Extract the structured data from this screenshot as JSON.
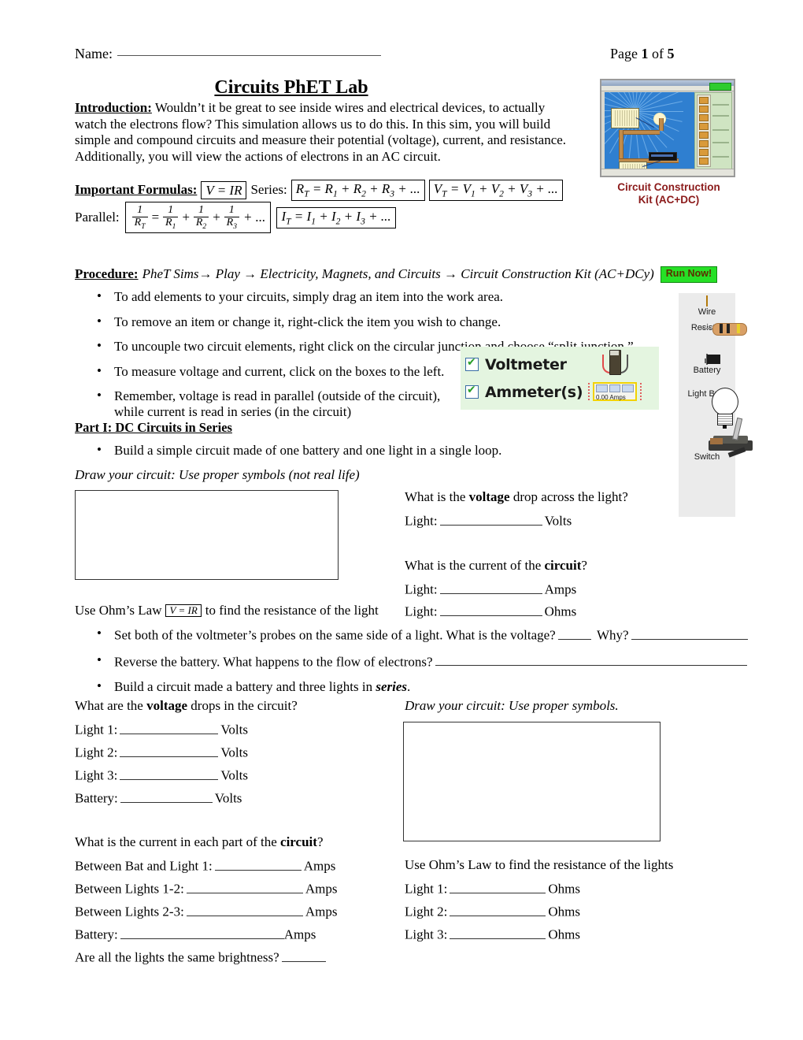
{
  "header": {
    "name_label": "Name:",
    "page_text_prefix": "Page ",
    "page_current": "1",
    "page_mid": " of ",
    "page_total": "5"
  },
  "title": "Circuits PhET Lab",
  "intro": {
    "heading": "Introduction:",
    "text": " Wouldn’t it be great to see inside wires and electrical devices, to actually watch the electrons flow?  This simulation allows us to do this.  In this sim, you will build simple and compound circuits and measure their potential (voltage), current, and resistance.  Additionally, you will view the actions of electrons in an AC circuit."
  },
  "phet_image": {
    "caption_line1": "Circuit Construction",
    "caption_line2": "Kit (AC+DC)",
    "caption_color": "#8b1a1a"
  },
  "formulas": {
    "label": "Important Formulas:",
    "ohms_law": "V = IR",
    "series_label": "Series:",
    "series_resistance": "RT = R1 + R2 + R3 + ...",
    "series_voltage": "VT = V1 + V2 + V3 + ...",
    "parallel_label": "Parallel:",
    "parallel_current": "IT = I1 + I2 + I3 + ..."
  },
  "procedure": {
    "label": "Procedure:",
    "path": "PheT Sims→ Play → Electricity, Magnets, and Circuits → Circuit Construction Kit (AC+DCy)",
    "run_button": "Run Now!",
    "bullets": [
      "To add elements to your circuits, simply drag an item into the work area.",
      "To remove an item or change it, right-click the item you wish to change.",
      "To uncouple two circuit elements, right click on the circular junction and choose “split junction.”",
      "To measure voltage and current, click on the boxes to the left.",
      "Remember, voltage is read in parallel (outside of the circuit),"
    ],
    "bullet5_line2": "while current is read in series (in the circuit)"
  },
  "meter_box": {
    "voltmeter_label": "Voltmeter",
    "ammeter_label": "Ammeter(s)",
    "voltmeter_checked": true,
    "ammeter_checked": true,
    "ammeter_reading": "0.00 Amps",
    "background_color": "#e4f5e0"
  },
  "parts_bar": {
    "items": [
      {
        "name": "wire",
        "label": "Wire"
      },
      {
        "name": "resistor",
        "label": "Resistor"
      },
      {
        "name": "battery",
        "label": "Battery"
      },
      {
        "name": "light-bulb",
        "label": "Light Bulb"
      },
      {
        "name": "switch",
        "label": "Switch"
      }
    ],
    "background_color": "#ebebeb"
  },
  "part1": {
    "heading": "Part I: DC Circuits in Series",
    "bullet": "Build a simple circuit made of one battery and one light in a single loop.",
    "draw_caption_1": "Draw your circuit: Use proper symbols (not real life)",
    "draw_caption_2": "Draw your circuit: Use proper symbols.",
    "q_voltage": "What is the ",
    "q_voltage_bold": "voltage",
    "q_voltage_tail": " drop across the light?",
    "a_voltage_label": "Light:",
    "a_voltage_unit": "Volts",
    "q_current": "What is the current of the ",
    "q_current_bold": "circuit",
    "q_current_tail": "?",
    "a_current_label": "Light:",
    "a_current_unit": "Amps",
    "ohm_line_pre": "Use Ohm’s Law ",
    "ohm_line_formula": "V = IR",
    "ohm_line_post": " to find the resistance of the light",
    "a_ohms_label": "Light:",
    "a_ohms_unit": "Ohms",
    "mid_bullets": [
      {
        "pre": "Set both of the voltmeter’s probes on the same side of a light.  What is the voltage?",
        "mid": "Why?",
        "post": ""
      },
      {
        "pre": "Reverse the battery.  What happens to the flow of electrons?",
        "mid": "",
        "post": ""
      }
    ],
    "bullet_series": {
      "pre": "Build a circuit made a battery and three lights in ",
      "bold_italic": "series",
      "post": "."
    },
    "q_vdrops_pre": "What are the ",
    "q_vdrops_bold": "voltage",
    "q_vdrops_tail": " drops in the circuit?",
    "voltage_rows": [
      {
        "label": "Light 1:",
        "unit": "Volts"
      },
      {
        "label": "Light 2:",
        "unit": "Volts"
      },
      {
        "label": "Light 3:",
        "unit": "Volts"
      },
      {
        "label": "Battery:",
        "unit": "Volts"
      }
    ],
    "q_current_each_pre": "What is the current in each part of the ",
    "q_current_each_bold": "circuit",
    "q_current_each_tail": "?",
    "current_rows": [
      {
        "label": "Between Bat and  Light 1:",
        "unit": "Amps"
      },
      {
        "label": "Between Lights 1-2:",
        "unit": "Amps"
      },
      {
        "label": "Between Lights 2-3:",
        "unit": "Amps"
      },
      {
        "label": "Battery:",
        "unit": "Amps"
      }
    ],
    "brightness_question": "Are all the lights the same brightness?",
    "ohm2_heading": "Use Ohm’s Law to find the resistance of the lights",
    "ohm2_rows": [
      {
        "label": "Light 1:",
        "unit": "Ohms"
      },
      {
        "label": "Light 2:",
        "unit": "Ohms"
      },
      {
        "label": "Light 3:",
        "unit": "Ohms"
      }
    ]
  }
}
